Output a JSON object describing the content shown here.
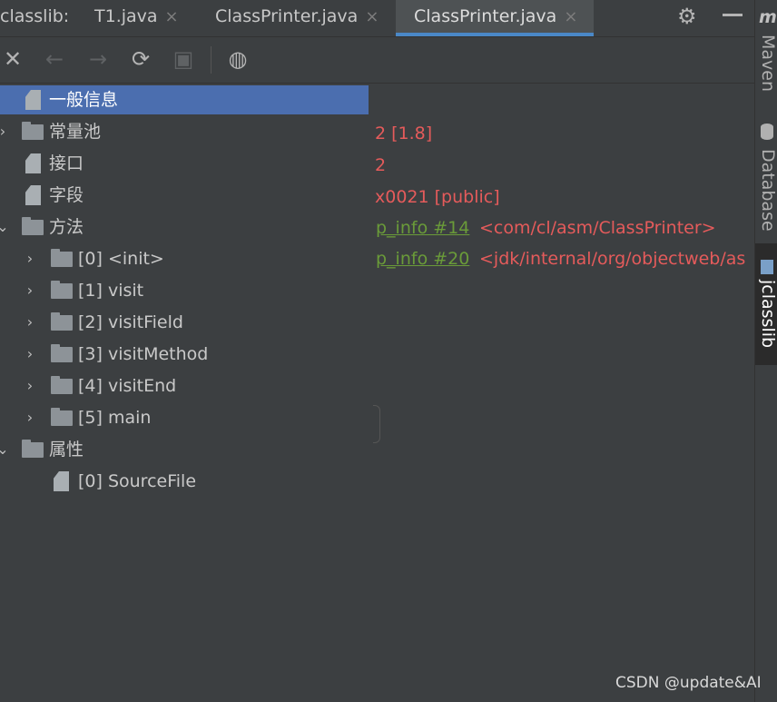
{
  "tabs": {
    "prefix": "classlib:",
    "items": [
      {
        "label": "T1.java",
        "close": "×"
      },
      {
        "label": "ClassPrinter.java",
        "close": "×"
      },
      {
        "label": "ClassPrinter.java",
        "close": "×"
      }
    ],
    "active_index": 2
  },
  "toolbar": {
    "icons": [
      "close-icon",
      "back-arrow-icon",
      "forward-arrow-icon",
      "refresh-icon",
      "save-icon",
      "globe-icon"
    ],
    "glyphs": [
      "✕",
      "←",
      "→",
      "⟳",
      "▣",
      "◍"
    ]
  },
  "tree": {
    "general": "一般信息",
    "constant_pool": "常量池",
    "interfaces": "接口",
    "fields": "字段",
    "methods": "方法",
    "method_items": [
      "[0] <init>",
      "[1] visit",
      "[2] visitField",
      "[3] visitMethod",
      "[4] visitEnd",
      "[5] main"
    ],
    "attributes": "属性",
    "attribute_items": [
      "[0] SourceFile"
    ]
  },
  "info": {
    "version": "2 [1.8]",
    "count": "2",
    "access": "x0021 [public]",
    "this_class_link": "p_info #14",
    "this_class_value": "<com/cl/asm/ClassPrinter>",
    "super_class_link": "p_info #20",
    "super_class_value": "<jdk/internal/org/objectweb/as"
  },
  "sidebar": {
    "maven": "Maven",
    "maven_logo": "m",
    "database": "Database",
    "jclasslib": "jclasslib"
  },
  "watermark": "CSDN @update&AI",
  "colors": {
    "accent": "#4a88c7",
    "selection": "#4b6eaf",
    "value_red": "#e55b5b",
    "link_green": "#6a9b39"
  }
}
